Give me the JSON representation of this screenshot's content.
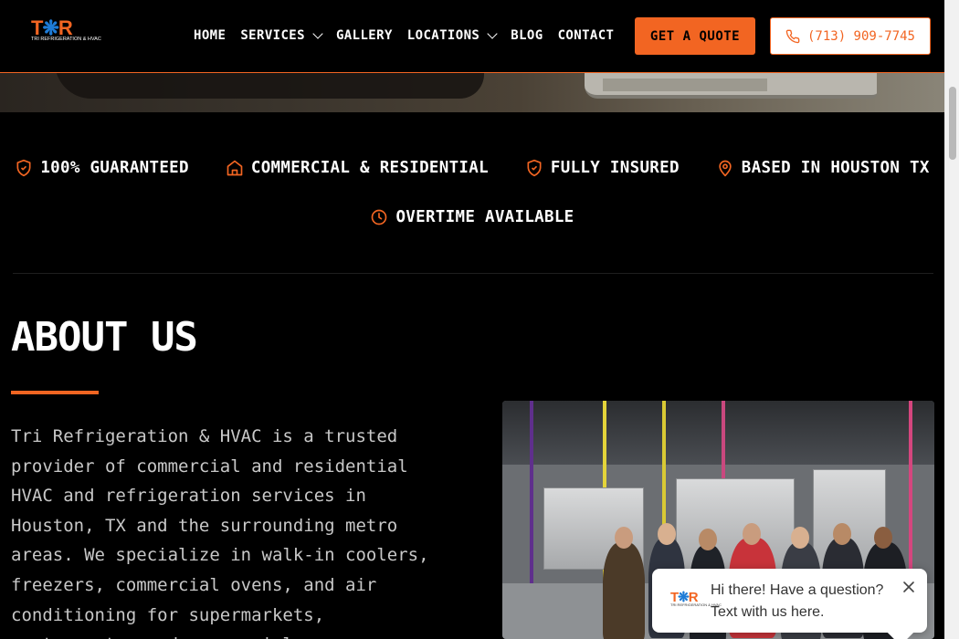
{
  "brand": {
    "logo_letters_1": "T",
    "logo_letters_2": "R",
    "logo_sub": "TRI REFRIGERATION & HVAC"
  },
  "nav": {
    "items": [
      {
        "label": "HOME"
      },
      {
        "label": "SERVICES"
      },
      {
        "label": "GALLERY"
      },
      {
        "label": "LOCATIONS"
      },
      {
        "label": "BLOG"
      },
      {
        "label": "CONTACT"
      }
    ],
    "cta_label": "GET A QUOTE",
    "phone_label": "(713) 909-7745"
  },
  "features": [
    {
      "label": "100% GUARANTEED",
      "icon": "shield-check-icon"
    },
    {
      "label": "COMMERCIAL & RESIDENTIAL",
      "icon": "home-icon"
    },
    {
      "label": "FULLY INSURED",
      "icon": "shield-check-icon"
    },
    {
      "label": "BASED IN HOUSTON TX",
      "icon": "map-pin-icon"
    },
    {
      "label": "OVERTIME AVAILABLE",
      "icon": "clock-icon"
    }
  ],
  "about": {
    "title": "ABOUT US",
    "body": "Tri Refrigeration & HVAC is a trusted provider of commercial and residential HVAC and refrigeration services in Houston, TX and the surrounding metro areas. We specialize in walk-in coolers, freezers, commercial ovens, and air conditioning for supermarkets, restaurants, and commercial"
  },
  "chat": {
    "message": "Hi there! Have a question? Text with us here."
  },
  "colors": {
    "accent": "#f26522",
    "brand_blue": "#1e7bd6",
    "background": "#000000"
  }
}
